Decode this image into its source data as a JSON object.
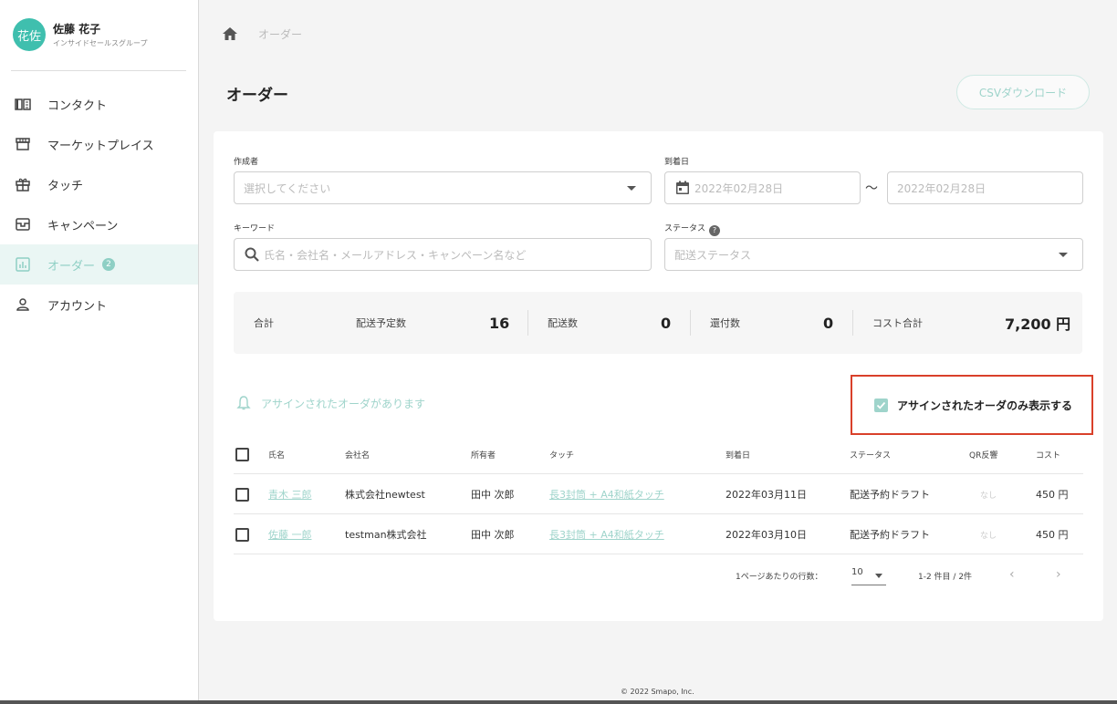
{
  "profile": {
    "avatar_text": "花佐",
    "name": "佐藤 花子",
    "group": "インサイドセールスグループ"
  },
  "sidebar": {
    "items": [
      {
        "label": "コンタクト",
        "icon": "book-icon"
      },
      {
        "label": "マーケットプレイス",
        "icon": "store-icon"
      },
      {
        "label": "タッチ",
        "icon": "gift-icon"
      },
      {
        "label": "キャンペーン",
        "icon": "campaign-box-icon"
      },
      {
        "label": "オーダー",
        "icon": "chart-icon",
        "badge": "2",
        "active": true
      },
      {
        "label": "アカウント",
        "icon": "person-icon"
      }
    ]
  },
  "breadcrumb": {
    "current": "オーダー"
  },
  "page": {
    "title": "オーダー",
    "csv_button": "CSVダウンロード"
  },
  "filters": {
    "creator_label": "作成者",
    "creator_placeholder": "選択してください",
    "arrival_label": "到着日",
    "arrival_from": "2022年02月28日",
    "arrival_sep": "〜",
    "arrival_to": "2022年02月28日",
    "keyword_label": "キーワード",
    "keyword_placeholder": "氏名・会社名・メールアドレス・キャンペーン名など",
    "status_label": "ステータス",
    "status_placeholder": "配送ステータス"
  },
  "summary": {
    "total_label": "合計",
    "scheduled_label": "配送予定数",
    "scheduled_value": "16",
    "shipped_label": "配送数",
    "shipped_value": "0",
    "returned_label": "還付数",
    "returned_value": "0",
    "cost_label": "コスト合計",
    "cost_value": "7,200 円"
  },
  "assigned_note": "アサインされたオーダがあります",
  "assigned_filter_label": "アサインされたオーダのみ表示する",
  "table": {
    "headers": {
      "name": "氏名",
      "company": "会社名",
      "owner": "所有者",
      "touch": "タッチ",
      "arrival": "到着日",
      "status": "ステータス",
      "qr": "QR反響",
      "cost": "コスト"
    },
    "rows": [
      {
        "name": "青木 三郎",
        "company": "株式会社newtest",
        "owner": "田中 次郎",
        "touch": "長3封筒 + A4和紙タッチ",
        "arrival": "2022年03月11日",
        "status": "配送予約ドラフト",
        "qr": "なし",
        "cost": "450 円"
      },
      {
        "name": "佐藤 一郎",
        "company": "testman株式会社",
        "owner": "田中 次郎",
        "touch": "長3封筒 + A4和紙タッチ",
        "arrival": "2022年03月10日",
        "status": "配送予約ドラフト",
        "qr": "なし",
        "cost": "450 円"
      }
    ]
  },
  "pagination": {
    "rows_per_page_label": "1ページあたりの行数：",
    "rows_per_page_value": "10",
    "range": "1-2 件目 / 2件"
  },
  "footer": "© 2022 Smapo, Inc.",
  "colors": {
    "accent": "#8ecfc4",
    "highlight_border": "#d9402a",
    "avatar": "#3fbfae"
  }
}
